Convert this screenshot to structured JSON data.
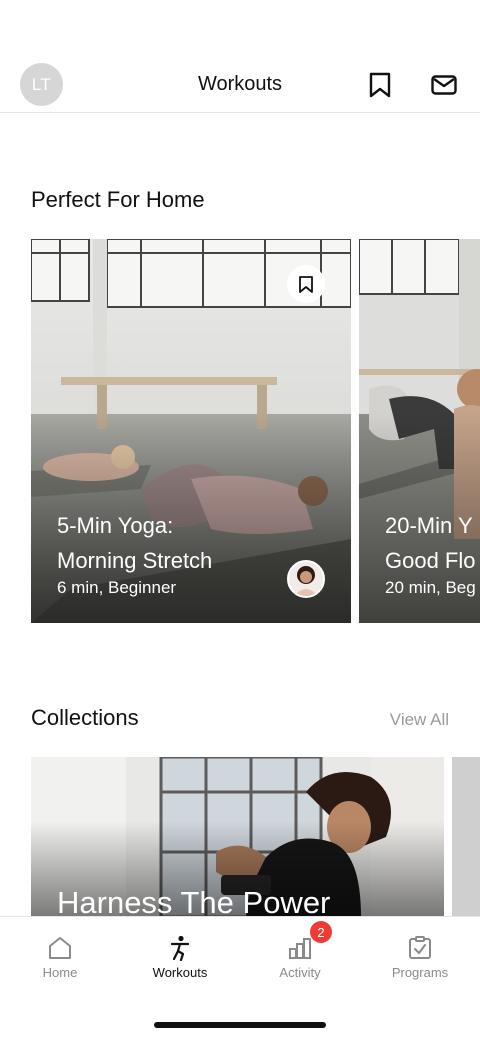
{
  "header": {
    "avatar_initials": "LT",
    "title": "Workouts",
    "bookmark_icon": "bookmark-icon",
    "mail_icon": "mail-icon"
  },
  "sections": {
    "perfect_for_home": {
      "title": "Perfect For Home",
      "cards": [
        {
          "title_line1": "5-Min Yoga:",
          "title_line2": "Morning Stretch",
          "subtitle": "6 min, Beginner"
        },
        {
          "title_line1": "20-Min Y",
          "title_line2": "Good Flo",
          "subtitle": "20 min, Beg"
        }
      ]
    },
    "collections": {
      "title": "Collections",
      "view_all": "View All",
      "cards": [
        {
          "title": "Harness The Power"
        }
      ]
    }
  },
  "tabbar": {
    "tabs": [
      {
        "label": "Home",
        "icon": "home-icon"
      },
      {
        "label": "Workouts",
        "icon": "workouts-icon",
        "active": true
      },
      {
        "label": "Activity",
        "icon": "activity-icon",
        "badge": "2"
      },
      {
        "label": "Programs",
        "icon": "programs-icon"
      }
    ]
  },
  "colors": {
    "badge": "#ef3b36",
    "avatar_bg": "#d6d6d6",
    "muted_text": "#8a8a8a"
  }
}
